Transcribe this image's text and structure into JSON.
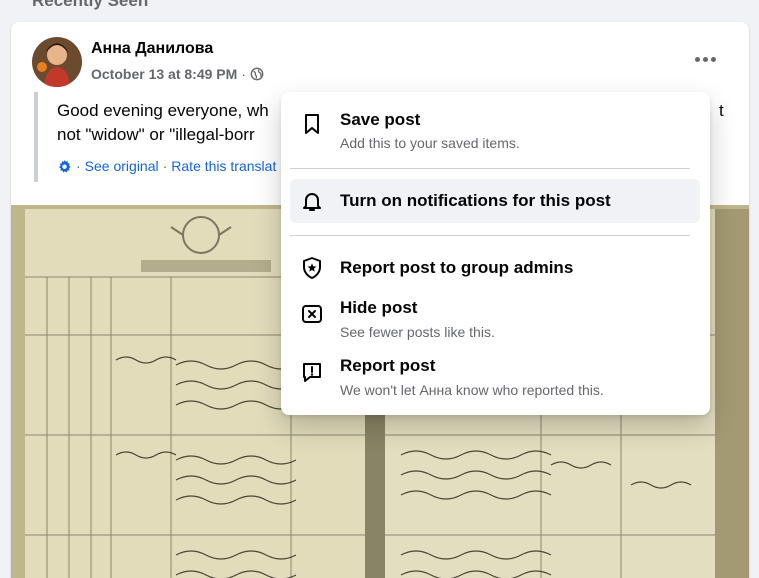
{
  "section": {
    "title": "Recently Seen"
  },
  "post": {
    "author": "Анна Данилова",
    "timestamp": "October 13 at 8:49 PM",
    "separator": "·",
    "audience_icon": "globe-icon",
    "text_line1": "Good evening everyone, wh",
    "text_line1_tail": "t",
    "text_line2": "not \"widow\" or \"illegal-borr",
    "translation": {
      "see_original": "See original",
      "rate": "Rate this translat",
      "sep": "·"
    }
  },
  "menu": {
    "items": [
      {
        "title": "Save post",
        "subtitle": "Add this to your saved items.",
        "icon": "bookmark-icon"
      },
      {
        "title": "Turn on notifications for this post",
        "subtitle": "",
        "icon": "bell-icon"
      },
      {
        "title": "Report post to group admins",
        "subtitle": "",
        "icon": "shield-star-icon"
      },
      {
        "title": "Hide post",
        "subtitle": "See fewer posts like this.",
        "icon": "close-box-icon"
      },
      {
        "title": "Report post",
        "subtitle": "We won't let Анна know who reported this.",
        "icon": "report-icon"
      }
    ]
  },
  "colors": {
    "accent": "#1664d8",
    "muted": "#65676b",
    "hover": "#f0f2f5"
  }
}
